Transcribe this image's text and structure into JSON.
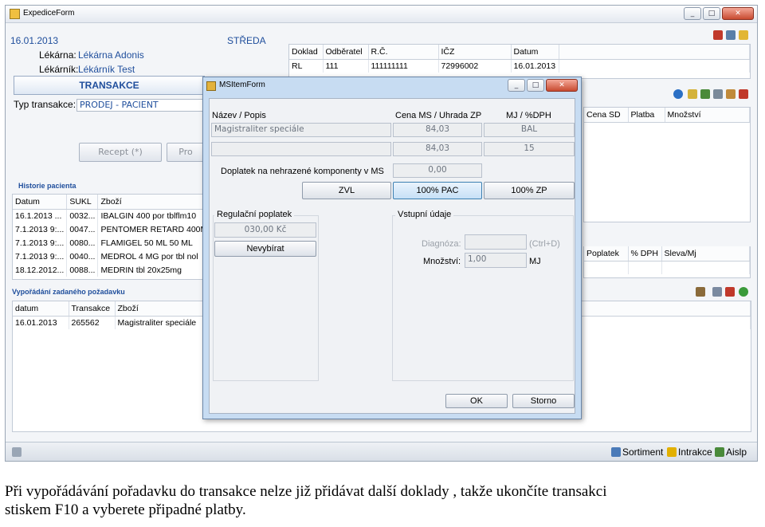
{
  "window": {
    "title": "ExpediceForm",
    "min": "_",
    "max": "□",
    "close": "✕"
  },
  "header": {
    "date": "16.01.2013",
    "day": "STŘEDA",
    "pharmacy_label": "Lékárna:",
    "pharmacy_value": "Lékárna Adonis",
    "pharmacist_label": "Lékárník:",
    "pharmacist_value": "Lékárník Test"
  },
  "transaction": {
    "banner": "TRANSAKCE",
    "type_label": "Typ transakce:",
    "type_value": "PRODEJ - PACIENT",
    "btn_recept": "Recept (*)",
    "btn_pro": "Pro"
  },
  "doc_grid": {
    "columns": [
      "Doklad",
      "Odběratel",
      "R.Č.",
      "IČZ",
      "Datum"
    ],
    "rows": [
      [
        "RL",
        "111",
        "111111111",
        "72996002",
        "16.01.2013"
      ]
    ]
  },
  "right_grid": {
    "columns": [
      "Cena SD",
      "Platba",
      "Množství"
    ]
  },
  "right_grid2": {
    "columns": [
      "Poplatek",
      "% DPH",
      "Sleva/Mj"
    ]
  },
  "history": {
    "title": "Historie pacienta",
    "columns": [
      "Datum",
      "SUKL",
      "Zboží"
    ],
    "rows": [
      [
        "16.1.2013 ...",
        "0032...",
        "IBALGIN 400 por tblflm10"
      ],
      [
        "7.1.2013 9:...",
        "0047...",
        "PENTOMER RETARD 400M"
      ],
      [
        "7.1.2013 9:...",
        "0080...",
        "FLAMIGEL 50 ML 50 ML"
      ],
      [
        "7.1.2013 9:...",
        "0040...",
        "MEDROL 4 MG por tbl nol"
      ],
      [
        "18.12.2012...",
        "0088...",
        "MEDRIN tbl 20x25mg"
      ]
    ]
  },
  "request": {
    "title": "Vypořádání zadaného požadavku",
    "columns": [
      "datum",
      "Transakce",
      "Zboží"
    ],
    "rows": [
      [
        "16.01.2013",
        "265562",
        "Magistraliter speciále"
      ]
    ]
  },
  "statusbar": {
    "sortiment": "Sortiment",
    "intrakce": "Intrakce",
    "aislp": "Aislp"
  },
  "dialog": {
    "title": "MSItemForm",
    "col_name": "Název / Popis",
    "col_price": "Cena MS / Uhrada ZP",
    "col_mj": "MJ / %DPH",
    "name_value": "Magistraliter speciále",
    "price1": "84,03",
    "mj_value": "BAL",
    "price2": "84,03",
    "dph_value": "15",
    "surcharge_label": "Doplatek na nehrazené komponenty v MS",
    "surcharge_value": "0,00",
    "btn_zvl": "ZVL",
    "btn_100pac": "100% PAC",
    "btn_100zp": "100% ZP",
    "reg_title": "Regulační poplatek",
    "reg_value": "030,00 Kč",
    "btn_nevybirat": "Nevybírat",
    "input_title": "Vstupní údaje",
    "diag_label": "Diagnóza:",
    "diag_hint": "(Ctrl+D)",
    "qty_label": "Množství:",
    "qty_value": "1,00",
    "qty_unit": "MJ",
    "btn_ok": "OK",
    "btn_storno": "Storno"
  },
  "caption": {
    "line1": "Při vypořádávání pořadavku do transakce nelze již přidávat další doklady , takže ukončíte transakci",
    "line2": "stiskem F10 a vyberete připadné platby."
  }
}
